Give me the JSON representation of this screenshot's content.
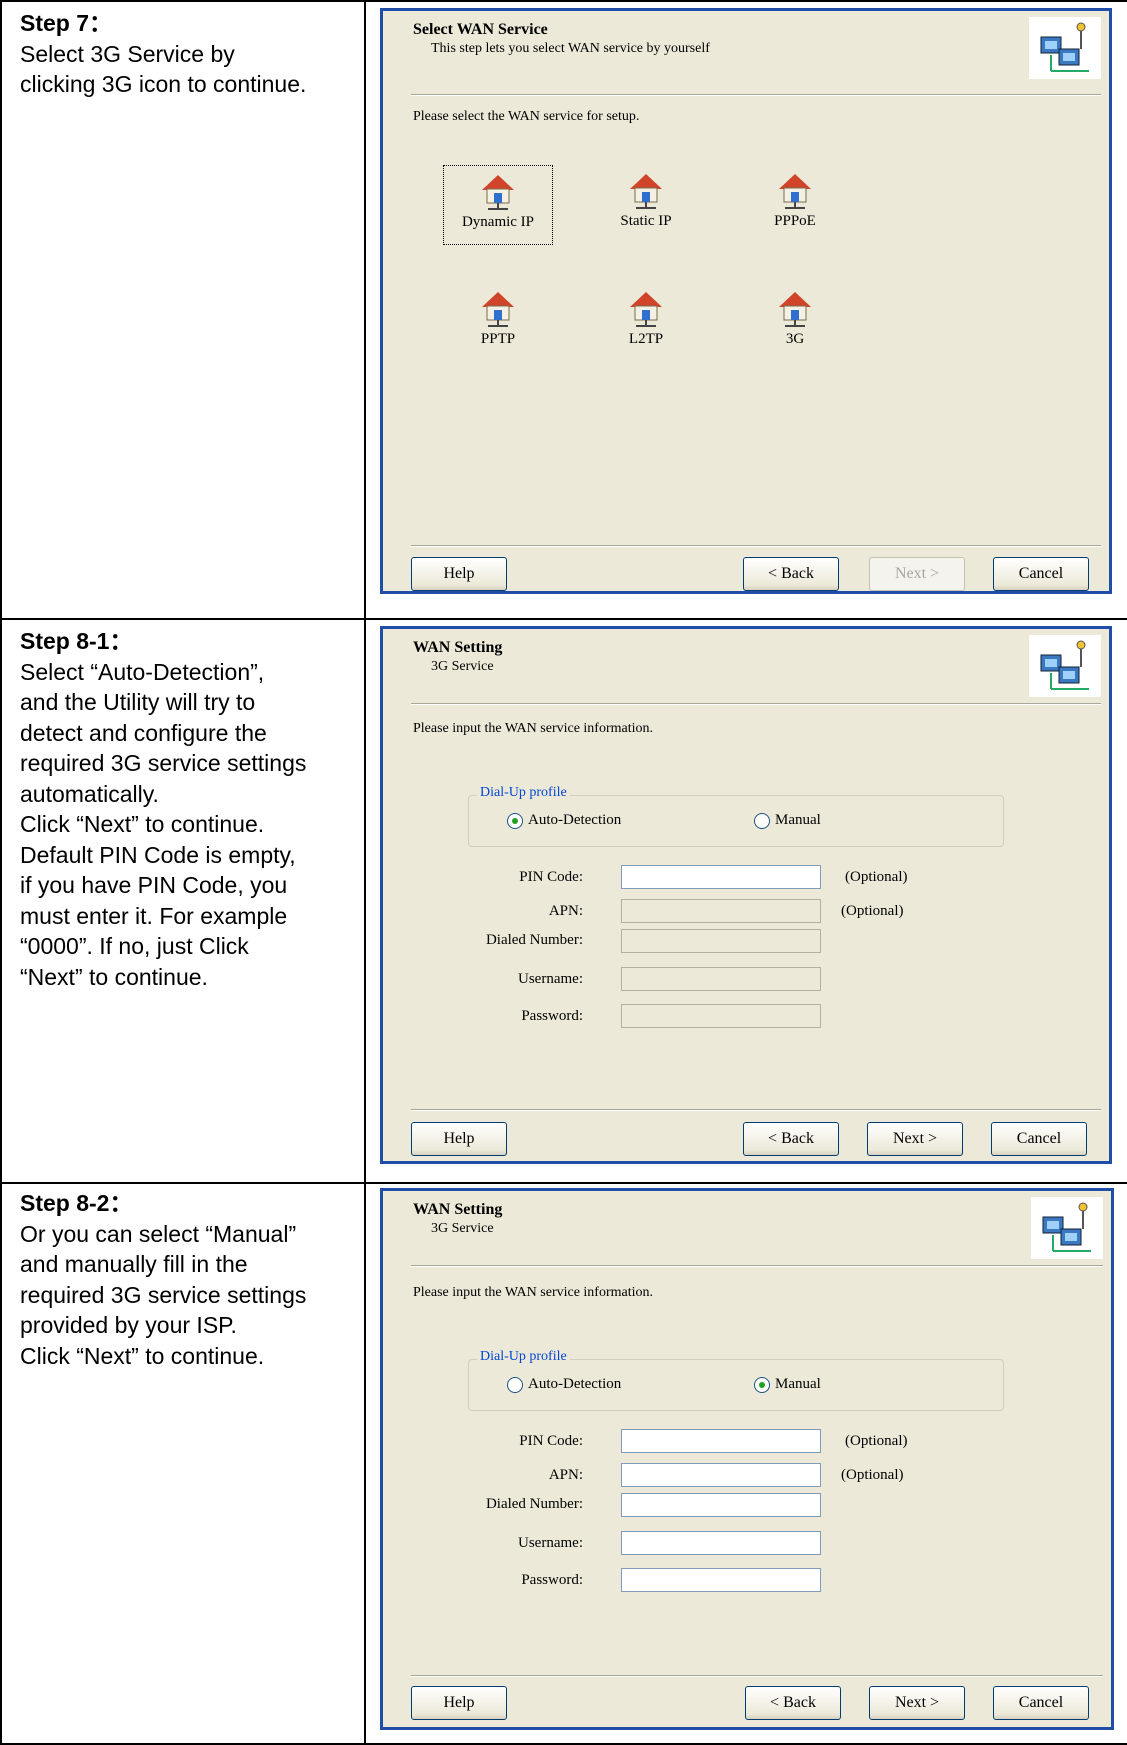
{
  "steps": [
    {
      "title": "Step 7：",
      "lines": [
        "Select 3G Service by",
        "clicking 3G icon to continue."
      ],
      "dialog": {
        "title": "Select WAN Service",
        "subtitle": "This step lets you select WAN service by yourself",
        "prompt": "Please select the WAN service for setup.",
        "services": [
          "Dynamic IP",
          "Static IP",
          "PPPoE",
          "PPTP",
          "L2TP",
          "3G"
        ],
        "buttons": {
          "help": "Help",
          "back": "< Back",
          "next": "Next >",
          "cancel": "Cancel"
        }
      }
    },
    {
      "title": "Step 8-1：",
      "lines": [
        "Select “Auto-Detection”,",
        "and the Utility will try to",
        "detect and configure the",
        "required 3G service settings",
        "automatically.",
        "Click “Next” to continue.",
        "Default PIN Code is empty,",
        "if you have PIN Code, you",
        "must enter it. For example",
        "“0000”. If no, just Click",
        "“Next” to continue."
      ],
      "dialog": {
        "title": "WAN Setting",
        "subtitle": "3G Service",
        "prompt": "Please input the WAN service information.",
        "group_label": "Dial-Up profile",
        "radio_auto": "Auto-Detection",
        "radio_manual": "Manual",
        "selected": "auto",
        "fields": [
          "PIN Code:",
          "APN:",
          "Dialed Number:",
          "Username:",
          "Password:"
        ],
        "optional": "(Optional)",
        "buttons": {
          "help": "Help",
          "back": "< Back",
          "next": "Next >",
          "cancel": "Cancel"
        }
      }
    },
    {
      "title": "Step 8-2：",
      "lines": [
        "Or you can select “Manual”",
        "and manually fill in the",
        "required 3G service settings",
        "provided by your ISP.",
        "Click “Next” to continue."
      ],
      "dialog": {
        "title": "WAN Setting",
        "subtitle": "3G Service",
        "prompt": "Please input the WAN service information.",
        "group_label": "Dial-Up profile",
        "radio_auto": "Auto-Detection",
        "radio_manual": "Manual",
        "selected": "manual",
        "fields": [
          "PIN Code:",
          "APN:",
          "Dialed Number:",
          "Username:",
          "Password:"
        ],
        "optional": "(Optional)",
        "buttons": {
          "help": "Help",
          "back": "< Back",
          "next": "Next >",
          "cancel": "Cancel"
        }
      }
    }
  ],
  "colors": {
    "dialog_bg": "#ece9d8",
    "dialog_border": "#1f4ea8",
    "legend": "#0046d5",
    "radio_dot": "#21a121"
  },
  "icons": {
    "service": "house-network-icon",
    "wizard": "network-computers-icon"
  }
}
